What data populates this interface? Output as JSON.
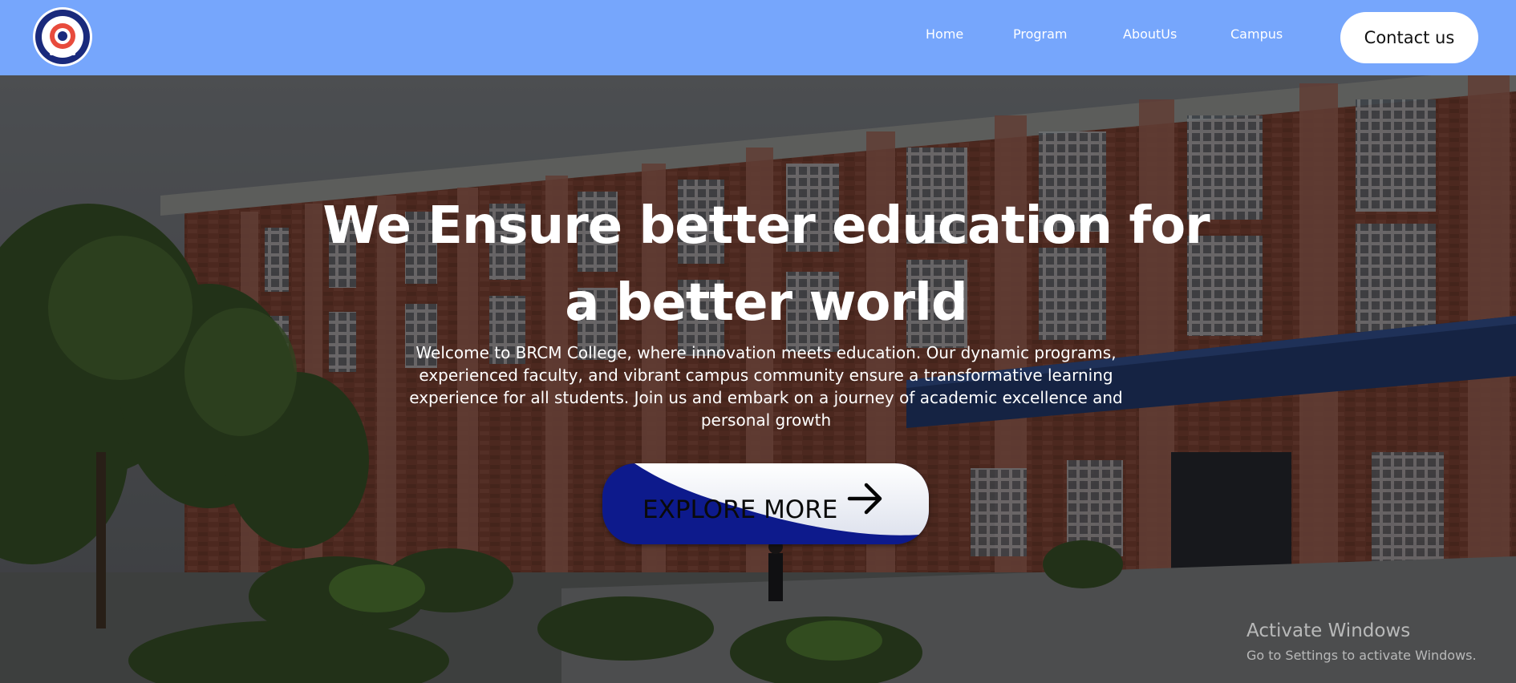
{
  "nav": {
    "home": "Home",
    "program": "Program",
    "about": "AboutUs",
    "campus": "Campus",
    "contact": "Contact us"
  },
  "hero": {
    "headline_line1": "We Ensure better education for",
    "headline_line2": "a better world",
    "intro": "Welcome to BRCM College, where innovation meets education. Our dynamic programs, experienced faculty, and vibrant campus community ensure a transformative learning experience for all students. Join us and embark on a journey of academic excellence and personal growth",
    "cta_label": "EXPLORE MORE"
  },
  "watermark": {
    "title": "Activate Windows",
    "subtitle": "Go to Settings to activate Windows."
  },
  "colors": {
    "header_bg": "#76a6fc",
    "cta_blue": "#0d1a8c",
    "contact_bg": "#ffffff"
  },
  "icons": {
    "logo": "college-emblem",
    "cta": "arrow-right-icon"
  }
}
